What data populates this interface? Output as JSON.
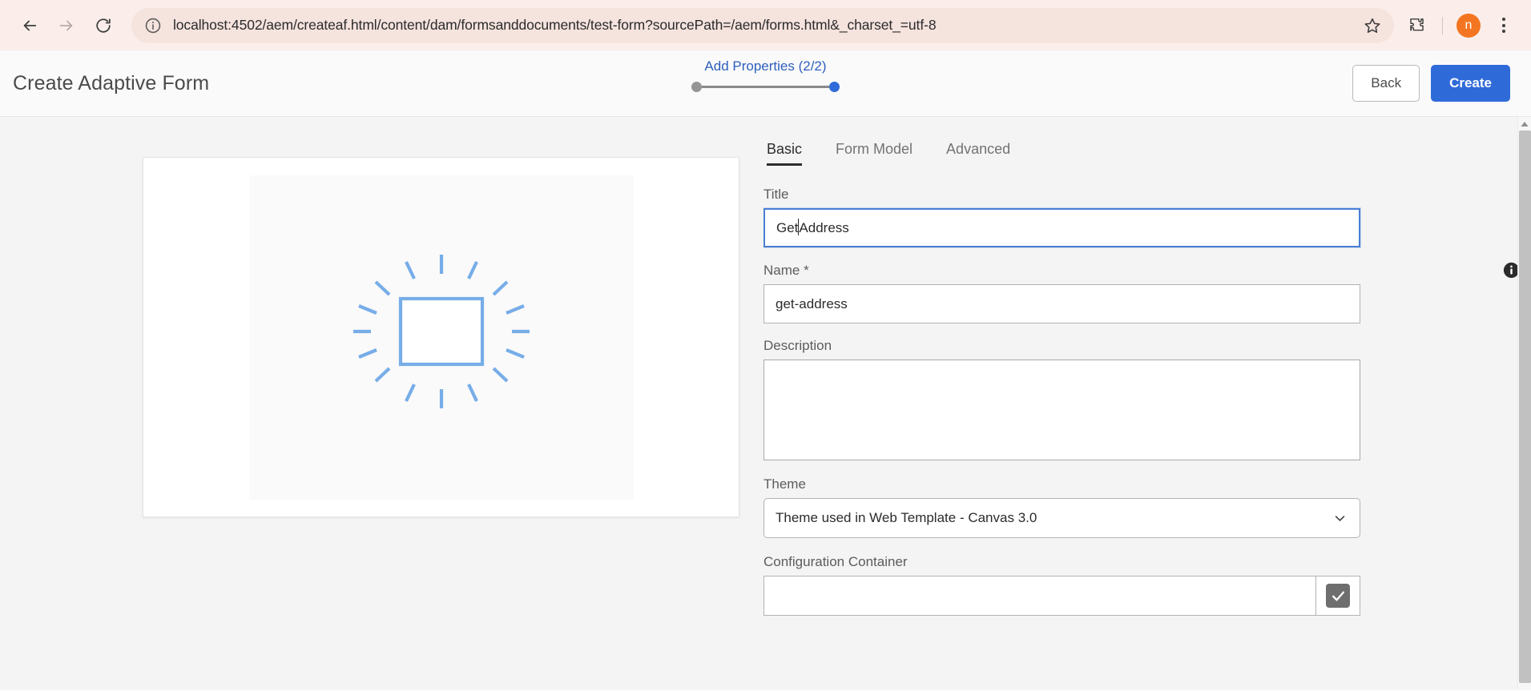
{
  "browser": {
    "back_label": "Back",
    "forward_label": "Forward",
    "reload_label": "Reload",
    "site_info_label": "View site information",
    "url": "localhost:4502/aem/createaf.html/content/dam/formsanddocuments/test-form?sourcePath=/aem/forms.html&_charset_=utf-8",
    "bookmark_label": "Bookmark this tab",
    "extensions_label": "Extensions",
    "profile_initial": "n",
    "menu_label": "Customize and control Google Chrome",
    "chrome_bg": "#fbeeea",
    "omnibox_bg": "#f5e3de",
    "avatar_color": "#f47521"
  },
  "header": {
    "title": "Create Adaptive Form",
    "step_label": "Add Properties (2/2)",
    "step_current": 2,
    "step_total": 2,
    "back_button": "Back",
    "create_button": "Create",
    "accent_color": "#2f6ad9"
  },
  "preview": {
    "thumbnail_alt": "blank form template thumbnail",
    "icon_color": "#77ade8"
  },
  "tabs": [
    {
      "label": "Basic",
      "active": true
    },
    {
      "label": "Form Model",
      "active": false
    },
    {
      "label": "Advanced",
      "active": false
    }
  ],
  "form": {
    "title": {
      "label": "Title",
      "value": "Get",
      "value_after_caret": "Address",
      "full_value": "Get Address",
      "focused": true
    },
    "name": {
      "label": "Name *",
      "value": "get-address",
      "info_tooltip": "info"
    },
    "description": {
      "label": "Description",
      "value": ""
    },
    "theme": {
      "label": "Theme",
      "selected": "Theme used in Web Template - Canvas 3.0"
    },
    "configuration_container": {
      "label": "Configuration Container",
      "value": "",
      "picker_label": "select configuration container"
    }
  }
}
